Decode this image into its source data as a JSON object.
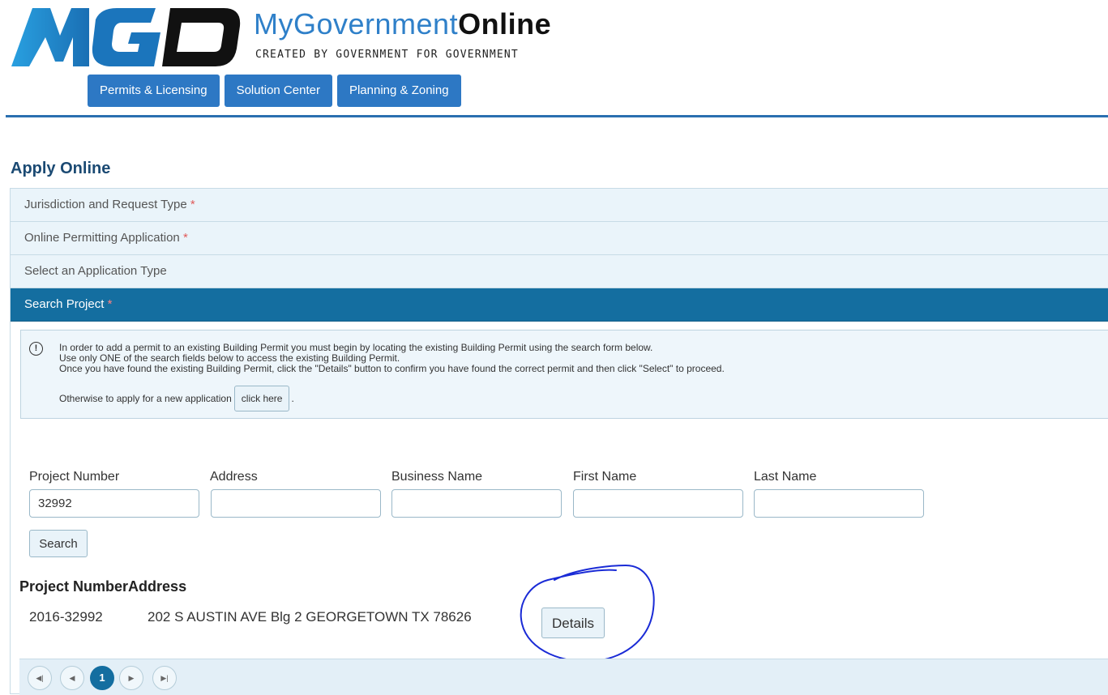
{
  "header": {
    "logo_text": "MGO",
    "brand_light": "MyGovernment",
    "brand_bold": "Online",
    "tagline": "CREATED BY GOVERNMENT FOR GOVERNMENT",
    "colors": {
      "brand_blue": "#1f88c9",
      "nav_blue": "#2d78c4",
      "active_teal": "#146ea0"
    }
  },
  "nav": [
    {
      "label": "Permits & Licensing"
    },
    {
      "label": "Solution Center"
    },
    {
      "label": "Planning & Zoning"
    }
  ],
  "page": {
    "title": "Apply Online"
  },
  "accordion": [
    {
      "label": "Jurisdiction and Request Type",
      "required": "*"
    },
    {
      "label": "Online Permitting Application",
      "required": "*"
    },
    {
      "label": "Select an Application Type",
      "required": ""
    },
    {
      "label": "Search Project",
      "required": "*"
    }
  ],
  "info": {
    "icon": "exclamation-circle-icon",
    "line1": "In order to add a permit to an existing Building Permit you must begin by locating the existing Building Permit using the search form below.",
    "line2": "Use only ONE of the search fields below to access the existing Building Permit.",
    "line3": "Once you have found the existing Building Permit, click the \"Details\" button to confirm you have found the correct permit and then click \"Select\" to proceed.",
    "line4_prefix": "Otherwise to apply for a new application",
    "click_here": "click here",
    "line4_suffix": "."
  },
  "search": {
    "fields": [
      {
        "label": "Project Number",
        "value": "32992"
      },
      {
        "label": "Address",
        "value": ""
      },
      {
        "label": "Business Name",
        "value": ""
      },
      {
        "label": "First Name",
        "value": ""
      },
      {
        "label": "Last Name",
        "value": ""
      }
    ],
    "button": "Search"
  },
  "results": {
    "headers": [
      "Project Number",
      "Address"
    ],
    "rows": [
      {
        "project_number": "2016-32992",
        "address": "202 S AUSTIN AVE Blg 2 GEORGETOWN TX 78626",
        "action": "Details"
      }
    ]
  },
  "pager": {
    "first": "first-page-icon",
    "prev": "prev-page-icon",
    "current": "1",
    "next": "next-page-icon",
    "last": "last-page-icon"
  }
}
